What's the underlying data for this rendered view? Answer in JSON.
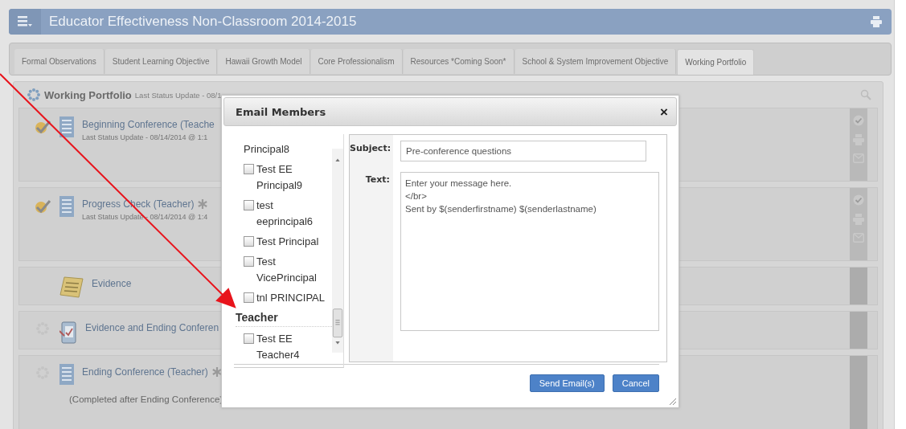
{
  "header": {
    "title": "Educator Effectiveness Non-Classroom 2014-2015"
  },
  "tabs": [
    {
      "label": "Formal Observations",
      "selected": false
    },
    {
      "label": "Student Learning Objective",
      "selected": false
    },
    {
      "label": "Hawaii Growth Model",
      "selected": false
    },
    {
      "label": "Core Professionalism",
      "selected": false
    },
    {
      "label": "Resources *Coming Soon*",
      "selected": false
    },
    {
      "label": "School & System Improvement Objective",
      "selected": false
    },
    {
      "label": "Working Portfolio",
      "selected": true
    }
  ],
  "portfolio": {
    "title": "Working Portfolio",
    "status": "Last Status Update - 08/1",
    "items": [
      {
        "kind": "completed",
        "title": "Beginning Conference (Teache",
        "star": false,
        "status": "Last Status Update - 08/14/2014 @ 1:1",
        "actions": true
      },
      {
        "kind": "completed",
        "title": "Progress Check (Teacher)",
        "star": true,
        "status": "Last Status Update - 08/14/2014 @ 1:4",
        "actions": true
      },
      {
        "kind": "evidence",
        "title": "Evidence",
        "star": false,
        "actions": false
      },
      {
        "kind": "pending-review",
        "title": "Evidence and Ending Conferen",
        "star": false,
        "actions": false
      },
      {
        "kind": "pending",
        "title": "Ending Conference (Teacher)",
        "star": true,
        "note": "(Completed after Ending Conference)",
        "actions": false
      }
    ]
  },
  "dialog": {
    "title": "Email Members",
    "close": "×",
    "recipients": [
      {
        "kind": "continuation",
        "label": "Principal8"
      },
      {
        "kind": "member",
        "label": "Test EE Principal9",
        "checked": false
      },
      {
        "kind": "member",
        "label": "test eeprincipal6",
        "checked": false
      },
      {
        "kind": "member",
        "label": "Test Principal",
        "checked": false
      },
      {
        "kind": "member",
        "label": "Test VicePrincipal",
        "checked": false
      },
      {
        "kind": "member",
        "label": "tnl PRINCIPAL",
        "checked": false
      },
      {
        "kind": "group",
        "label": "Teacher"
      },
      {
        "kind": "member",
        "label": "Test EE Teacher4",
        "checked": false
      }
    ],
    "subject_label": "Subject:",
    "subject": "Pre-conference questions",
    "text_label": "Text:",
    "text": "Enter your message here.\n</br>\nSent by $(senderfirstname) $(senderlastname)",
    "buttons": [
      "Send Email(s)",
      "Cancel"
    ]
  }
}
